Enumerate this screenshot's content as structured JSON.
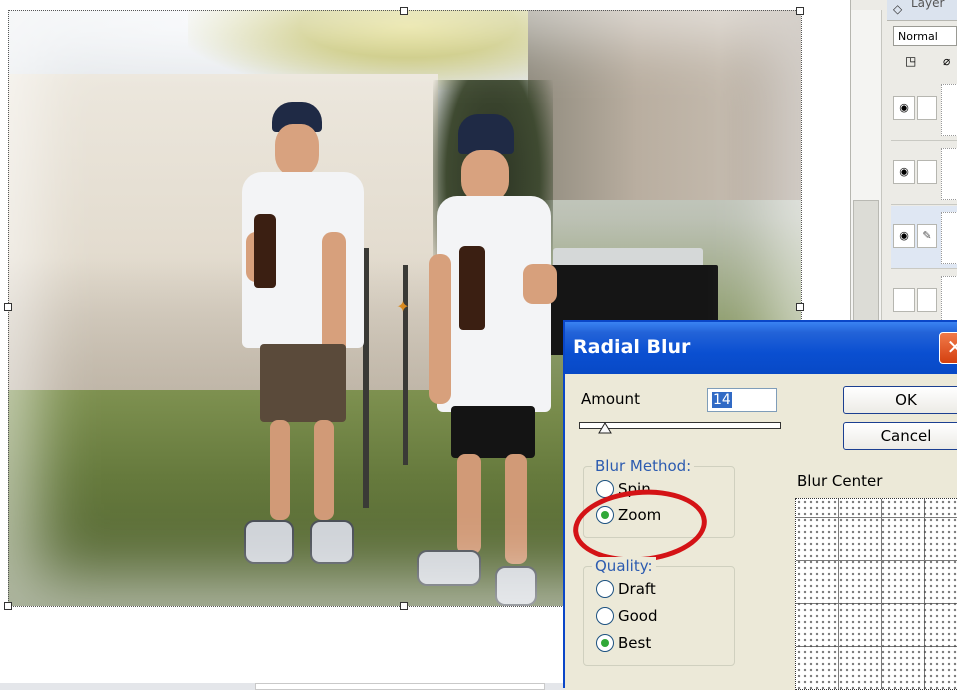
{
  "layers_panel": {
    "header_label": "Layer",
    "blend_mode": "Normal",
    "layers": [
      {
        "visible": true,
        "linked": false,
        "brush": false
      },
      {
        "visible": true,
        "linked": false,
        "brush": false
      },
      {
        "visible": true,
        "linked": false,
        "brush": true
      },
      {
        "visible": false,
        "linked": false,
        "brush": false
      }
    ]
  },
  "dialog": {
    "title": "Radial Blur",
    "amount_label": "Amount",
    "amount_value": "14",
    "ok_label": "OK",
    "cancel_label": "Cancel",
    "blur_method": {
      "title": "Blur Method:",
      "options": [
        "Spin",
        "Zoom"
      ],
      "selected": "Zoom"
    },
    "quality": {
      "title": "Quality:",
      "options": [
        "Draft",
        "Good",
        "Best"
      ],
      "selected": "Best"
    },
    "blur_center_label": "Blur Center"
  },
  "colors": {
    "title_bar": "#0a4fd1",
    "annotation_circle": "#d41316",
    "radio_selected": "#31a838"
  },
  "icons": {
    "visibility": "eye-icon",
    "brush": "brush-icon",
    "close": "close-icon",
    "center_marker": "crosshair-icon"
  }
}
